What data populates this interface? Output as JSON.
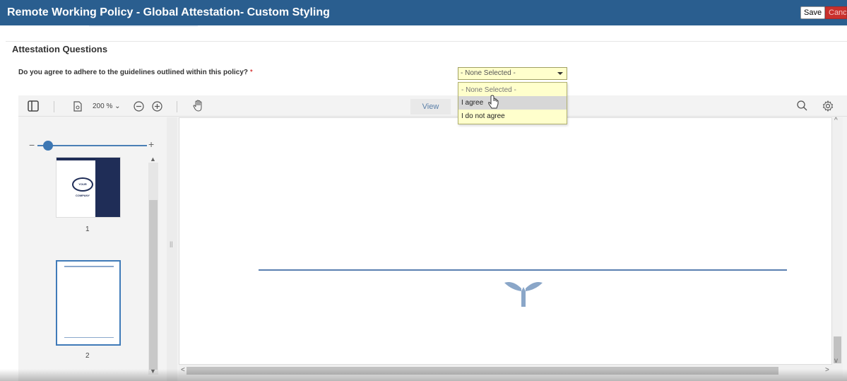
{
  "header": {
    "title": "Remote Working Policy - Global Attestation- Custom Styling",
    "save_label": "Save",
    "cancel_label": "Cancel"
  },
  "section": {
    "title": "Attestation Questions"
  },
  "question": {
    "text": "Do you agree to adhere to the guidelines outlined within this policy?",
    "required_marker": "*",
    "selected": "- None Selected -",
    "options": [
      "- None Selected -",
      "I agree",
      "I do not agree"
    ],
    "hovered_option": "I agree"
  },
  "viewer": {
    "zoom": "200 %",
    "view_label": "View",
    "thumbnails": [
      {
        "page": "1",
        "logo_text": "YOUR COMPANY"
      },
      {
        "page": "2"
      }
    ]
  },
  "colors": {
    "title_bar": "#2a5e8f",
    "cancel": "#c9302c",
    "select_bg": "#ffffcc",
    "accent": "#3d77b3"
  }
}
